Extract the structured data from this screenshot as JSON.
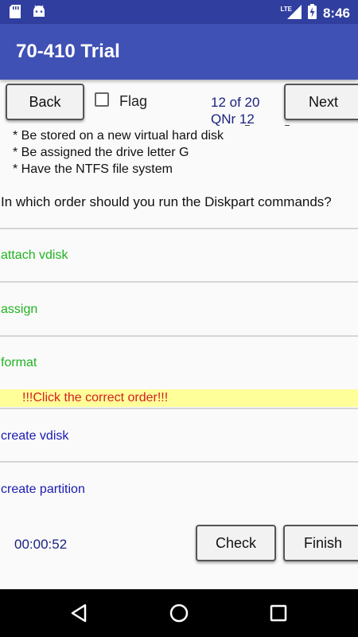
{
  "status_bar": {
    "network_label": "LTE",
    "time": "8:46",
    "icons": [
      "sd-card-icon",
      "android-icon",
      "signal-icon",
      "battery-charging-icon"
    ]
  },
  "app_bar": {
    "title": "70-410 Trial"
  },
  "toolbar": {
    "back_label": "Back",
    "flag_label": "Flag",
    "flag_checked": false,
    "counter": "12 of 20",
    "qnr": "QNr  12",
    "next_label": "Next"
  },
  "question": {
    "bullets": [
      "* Be stored on a new virtual hard disk",
      "* Be assigned the drive letter G",
      "* Have the NTFS file system"
    ],
    "prompt": "In which order should you run the Diskpart commands?"
  },
  "selected_answers": [
    "attach vdisk",
    "assign",
    "format"
  ],
  "instruction": "!!!Click the correct order!!!",
  "available_answers": [
    "create vdisk",
    "create partition"
  ],
  "footer": {
    "timer": "00:00:52",
    "check_label": "Check",
    "finish_label": "Finish"
  },
  "colors": {
    "status_bar": "#303f9f",
    "app_bar": "#3f51b5",
    "selected_answer": "#21b321",
    "available_answer": "#1a1ab3",
    "instruction_bg": "#ffff99",
    "instruction_text": "#d32020"
  }
}
